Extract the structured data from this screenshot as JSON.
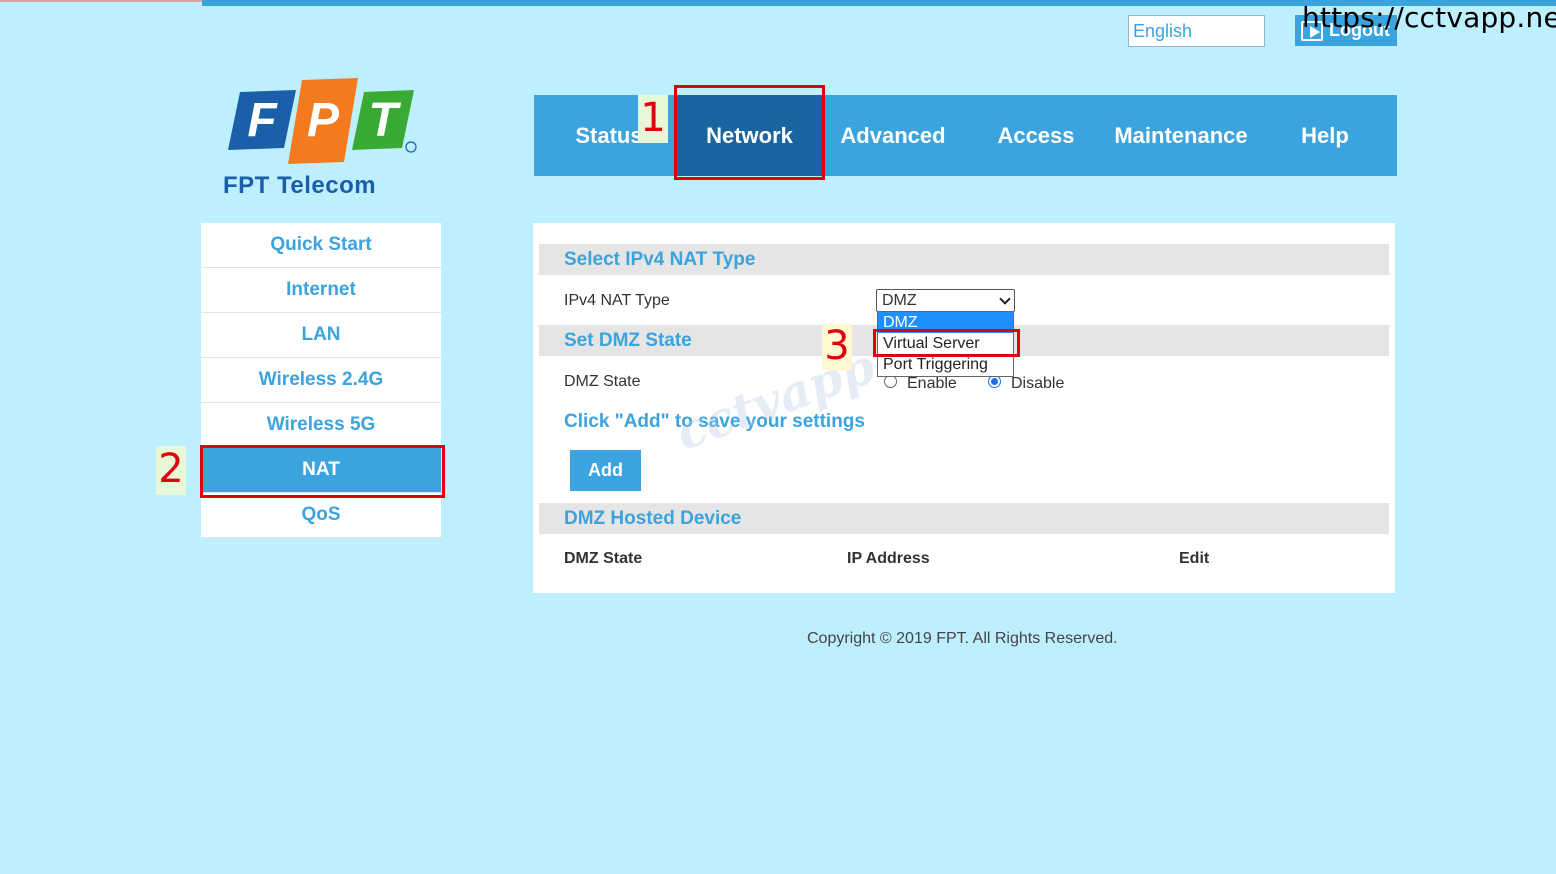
{
  "header": {
    "language": "English",
    "logout_label": "Logout",
    "watermark_url": "https://cctvapp.net"
  },
  "logo": {
    "letters": [
      "F",
      "P",
      "T"
    ],
    "caption": "FPT Telecom",
    "colors": {
      "blue": "#1a5fa8",
      "orange": "#f47a20",
      "green": "#3aaa35"
    }
  },
  "nav": {
    "items": [
      "Status",
      "Network",
      "Advanced",
      "Access",
      "Maintenance",
      "Help"
    ],
    "active": "Network"
  },
  "sidebar": {
    "items": [
      "Quick Start",
      "Internet",
      "LAN",
      "Wireless 2.4G",
      "Wireless 5G",
      "NAT",
      "QoS"
    ],
    "active": "NAT"
  },
  "steps": [
    "1",
    "2",
    "3"
  ],
  "main": {
    "nat_type_section": "Select IPv4 NAT Type",
    "nat_type_label": "IPv4 NAT Type",
    "nat_type_value": "DMZ",
    "nat_type_options": [
      "DMZ",
      "Virtual Server",
      "Port Triggering"
    ],
    "dmz_section": "Set DMZ State",
    "dmz_state_label": "DMZ State",
    "radio_enable": "Enable",
    "radio_disable": "Disable",
    "hint": "Click \"Add\" to save your settings",
    "add_label": "Add",
    "hosted_section": "DMZ Hosted Device",
    "table_columns": [
      "DMZ State",
      "IP Address",
      "Edit"
    ]
  },
  "footer": {
    "copyright": "Copyright © 2019 FPT. All Rights Reserved."
  }
}
